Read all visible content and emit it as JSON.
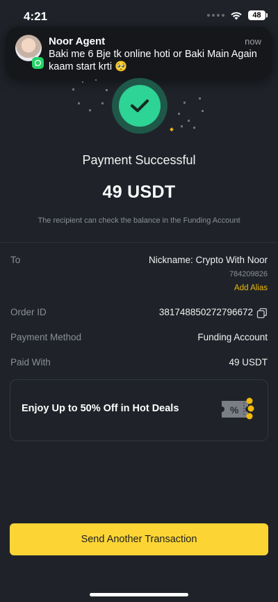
{
  "status_bar": {
    "time": "4:21",
    "battery": "48",
    "icons": [
      "signal-icon",
      "wifi-icon",
      "battery-icon"
    ]
  },
  "notification": {
    "sender": "Noor Agent",
    "time": "now",
    "message": "Baki me 6 Bje tk online hoti or Baki Main Again kaam start krti 🥺",
    "app_icon": "whatsapp-icon"
  },
  "result": {
    "icon": "checkmark-icon",
    "title": "Payment Successful",
    "amount": "49 USDT",
    "note": "The recipient can check the balance in the Funding Account"
  },
  "details": {
    "to_label": "To",
    "to_nickname": "Nickname: Crypto With Noor",
    "to_id": "784209826",
    "add_alias": "Add Alias",
    "order_label": "Order ID",
    "order_id": "381748850272796672",
    "method_label": "Payment Method",
    "method_value": "Funding Account",
    "paid_label": "Paid With",
    "paid_value": "49 USDT"
  },
  "promo": {
    "text": "Enjoy Up to 50% Off in Hot Deals",
    "icon": "discount-ticket-icon"
  },
  "send_button": "Send Another Transaction",
  "colors": {
    "background": "#1f2329",
    "success": "#2ed396",
    "accent": "#fcd535",
    "link": "#f0b90b"
  }
}
